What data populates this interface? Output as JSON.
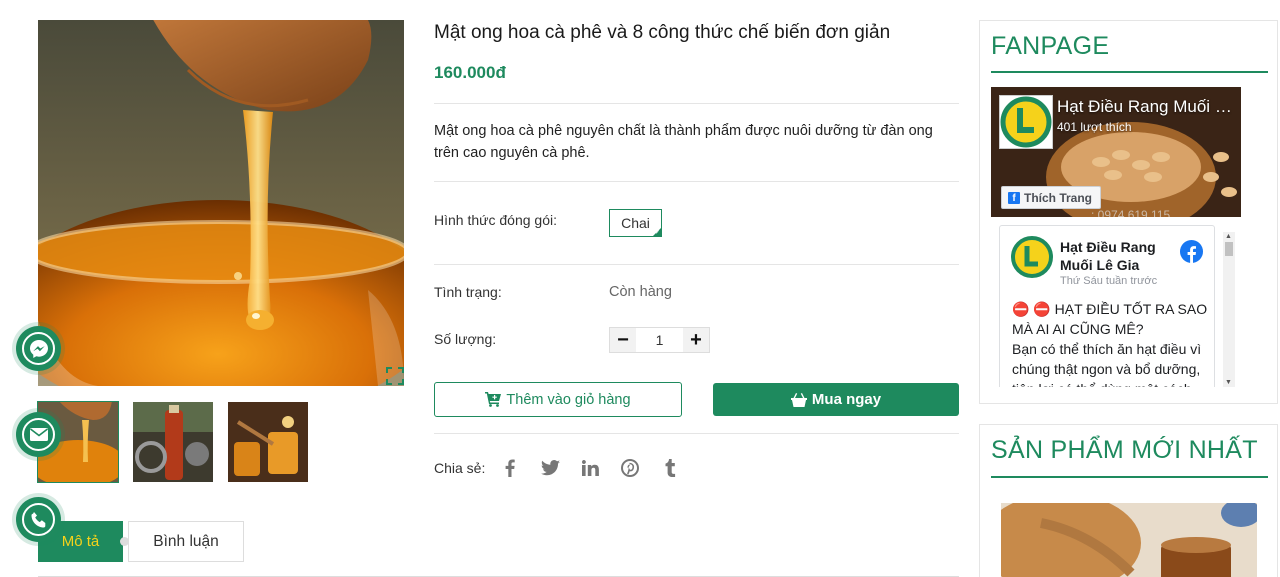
{
  "product": {
    "title": "Mật ong hoa cà phê và 8 công thức chế biến đơn giản",
    "price": "160.000đ",
    "description": "Mật ong hoa cà phê nguyên chất là thành phẩm được nuôi dưỡng từ đàn ong trên cao nguyên cà phê.",
    "packaging_label": "Hình thức đóng gói:",
    "packaging_option": "Chai",
    "status_label": "Tình trạng:",
    "status_value": "Còn hàng",
    "quantity_label": "Số lượng:",
    "quantity_value": "1",
    "add_to_cart": "Thêm vào giỏ hàng",
    "buy_now": "Mua ngay",
    "share_label": "Chia sẻ:"
  },
  "tabs": [
    {
      "label": "Mô tả"
    },
    {
      "label": "Bình luận"
    }
  ],
  "sidebar": {
    "fanpage_title": "FANPAGE",
    "newest_title": "SẢN PHẨM MỚI NHẤT",
    "fb": {
      "page_name": "Hạt Điều Rang Muối Lê Gia",
      "likes": "401 lượt thích",
      "like_button": "Thích Trang",
      "phone_partial": "...: 0974 619 115",
      "post_author": "Hạt Điều Rang Muối Lê Gia",
      "post_time": "Thứ Sáu tuần trước",
      "post_headline": "⛔ ⛔ HẠT ĐIỀU TỐT RA SAO MÀ AI AI CŨNG MÊ?",
      "post_body": "Bạn có thể thích ăn hạt điều vì chúng thật ngon và bổ dưỡng, tiện lợi có thể dùng một cách"
    }
  },
  "colors": {
    "brand_green": "#1e8a5e",
    "tab_text_yellow": "#f5d21b",
    "facebook_blue": "#1877f2"
  }
}
